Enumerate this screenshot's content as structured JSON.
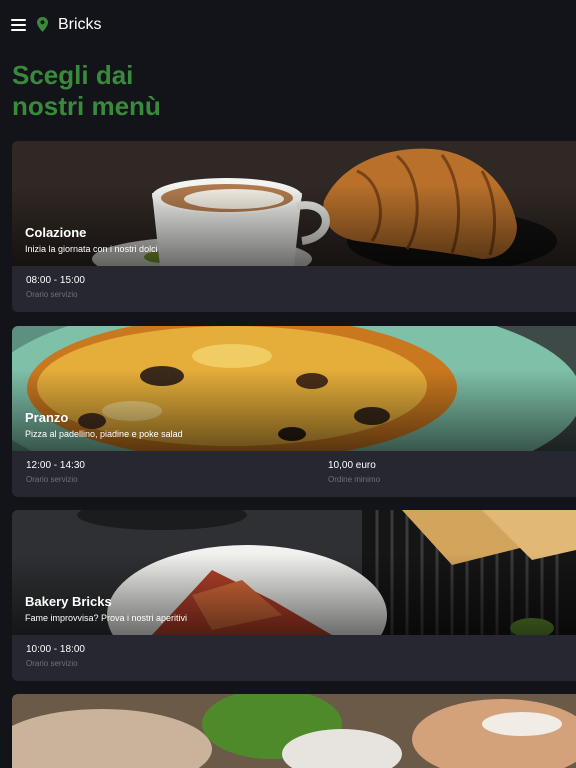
{
  "header": {
    "menu_icon": "hamburger-menu-icon",
    "location_icon": "location-pin-icon",
    "brand": "Bricks",
    "accent_color": "#3a8a3c"
  },
  "headline": {
    "line1": "Scegli dai",
    "line2": "nostri menù"
  },
  "menus": [
    {
      "title": "Colazione",
      "description": "Inizia la giornata con i nostri dolci",
      "hours": "08:00 - 15:00",
      "hours_label": "Orario servizio"
    },
    {
      "title": "Pranzo",
      "description": "Pizza al padellino, piadine e poke salad",
      "hours": "12:00 - 14:30",
      "hours_label": "Orario servizio",
      "min_order": "10,00 euro",
      "min_order_label": "Ordine minimo"
    },
    {
      "title": "Bakery Bricks",
      "description": "Fame improvvisa? Prova i nostri aperitivi",
      "hours": "10:00 - 18:00",
      "hours_label": "Orario servizio"
    },
    {
      "title": "",
      "description": ""
    }
  ]
}
